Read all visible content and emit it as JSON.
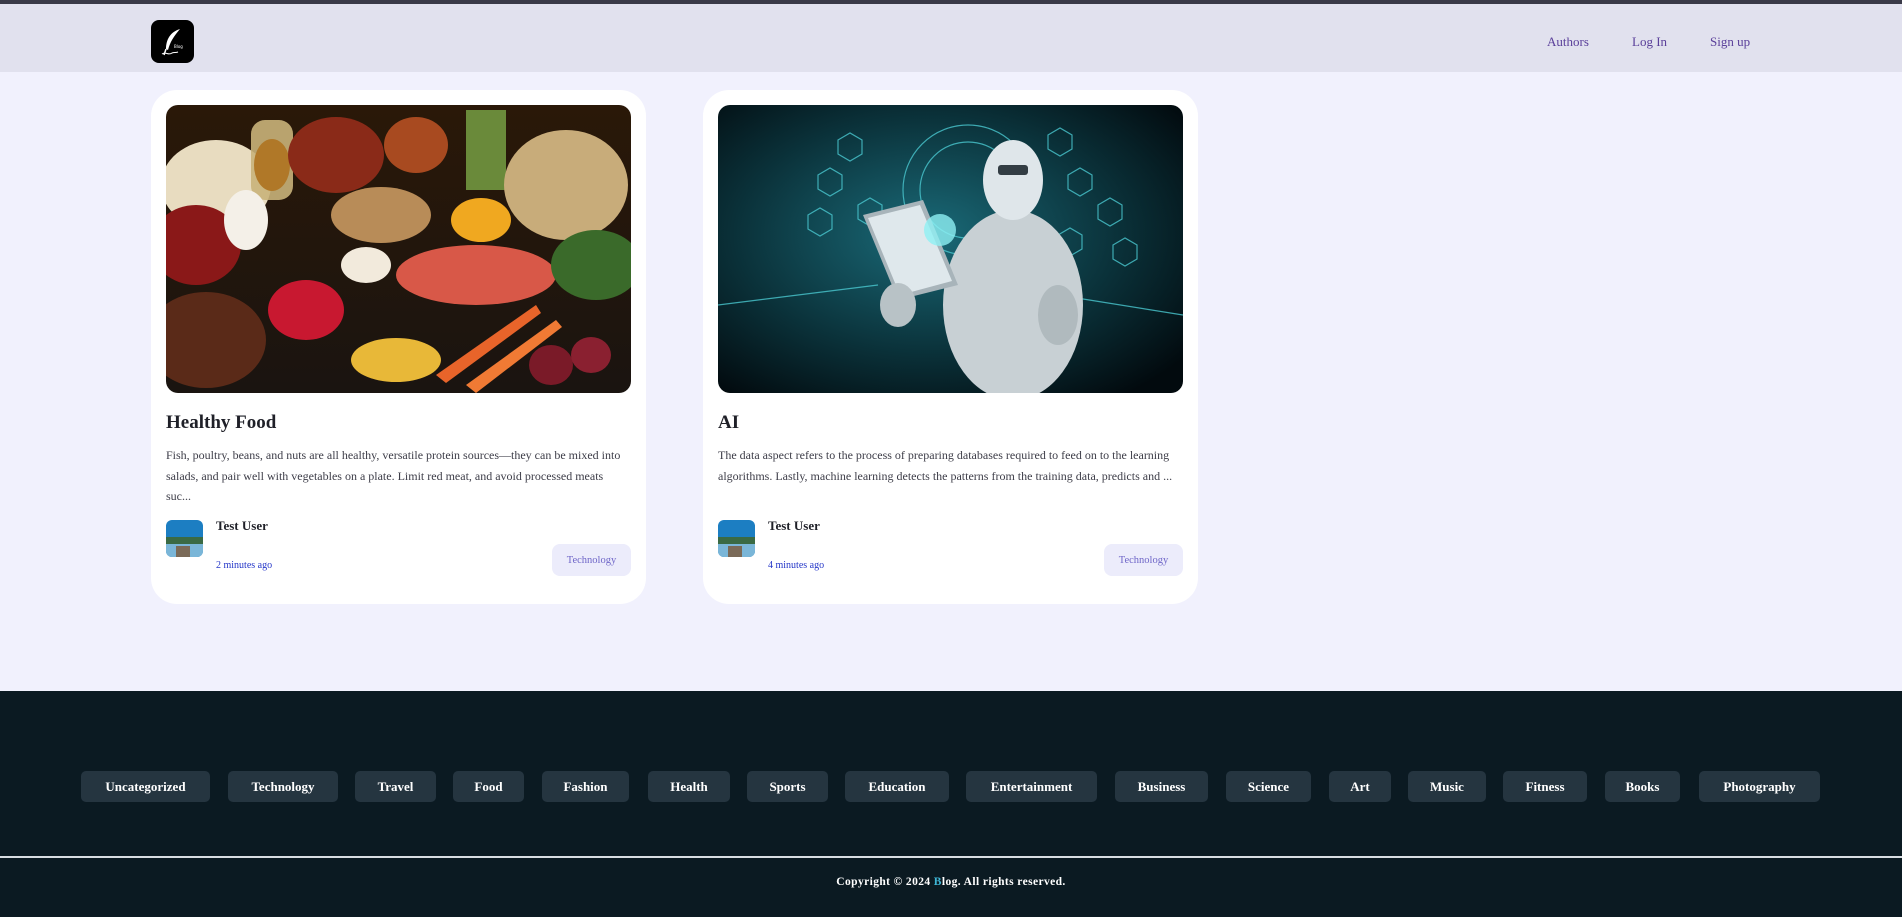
{
  "nav": {
    "authors": "Authors",
    "login": "Log In",
    "signup": "Sign up"
  },
  "logo": {
    "icon": "quill-icon",
    "text": "Blog"
  },
  "posts": [
    {
      "title": "Healthy Food",
      "excerpt": "Fish, poultry, beans, and nuts are all healthy, versatile protein sources—they can be mixed into salads, and pair well with vegetables on a plate. Limit red meat, and avoid processed meats suc...",
      "author": "Test User",
      "time": "2 minutes ago",
      "tag": "Technology",
      "image": "food-image"
    },
    {
      "title": "AI",
      "excerpt": "The data aspect refers to the process of preparing databases required to feed on to the learning algorithms. Lastly, machine learning detects the patterns from the training data, predicts and ...",
      "author": "Test User",
      "time": "4 minutes ago",
      "tag": "Technology",
      "image": "robot-image"
    }
  ],
  "categories": [
    "Uncategorized",
    "Technology",
    "Travel",
    "Food",
    "Fashion",
    "Health",
    "Sports",
    "Education",
    "Entertainment",
    "Business",
    "Science",
    "Art",
    "Music",
    "Fitness",
    "Books",
    "Photography"
  ],
  "footer": {
    "copyright_pre": "Copyright © 2024 ",
    "brand_b": "B",
    "copyright_post": "log. All rights reserved."
  },
  "colors": {
    "accent": "#5a3f9a",
    "footer_bg": "#0b1a22",
    "page_bg": "#f1f1fd"
  }
}
